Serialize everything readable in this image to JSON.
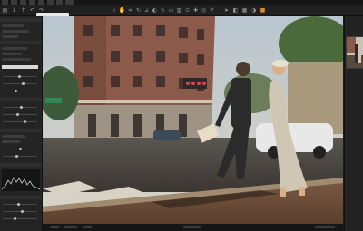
{
  "colors": {
    "accent": "#e08a2d",
    "panel": "#242424",
    "toolbar": "#202020",
    "viewer_bg": "#6b665e"
  },
  "toolbar": {
    "left_icons": [
      "folder-icon",
      "import-icon",
      "export-icon",
      "undo-icon",
      "redo-icon",
      "settings-icon"
    ],
    "center_icons": [
      "zoom-icon",
      "hand-icon",
      "crop-icon",
      "rotate-icon",
      "keystone-icon",
      "mask-icon",
      "brush-icon",
      "eraser-icon",
      "gradient-icon",
      "picker-icon",
      "heal-icon",
      "clone-icon",
      "annotate-icon"
    ],
    "right_icons": [
      "cursor-icon",
      "compare-icon",
      "grid-icon",
      "exposure-icon",
      "proof-icon",
      "orange-alert-icon"
    ]
  },
  "viewer": {
    "image": "street-photo"
  }
}
